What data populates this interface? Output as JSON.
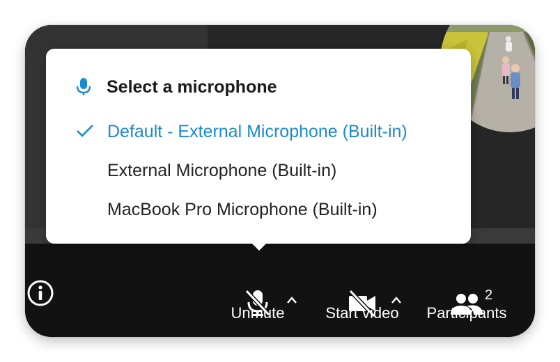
{
  "microphone_menu": {
    "title": "Select a microphone",
    "items": [
      {
        "label": "Default - External Microphone (Built-in)",
        "selected": true
      },
      {
        "label": "External Microphone (Built-in)",
        "selected": false
      },
      {
        "label": "MacBook Pro Microphone (Built-in)",
        "selected": false
      }
    ]
  },
  "toolbar": {
    "unmute_label": "Unmute",
    "start_video_label": "Start video",
    "participants_label": "Participants",
    "participants_count": "2"
  },
  "icons": {
    "menu_header": "microphone-icon",
    "selected_marker": "checkmark-icon",
    "info": "info-icon",
    "unmute": "microphone-muted-icon",
    "video": "video-off-icon",
    "participants": "participants-icon",
    "chevron": "chevron-up-icon"
  },
  "colors": {
    "accent": "#1a8ad0",
    "toolbar_bg": "#121212",
    "popup_bg": "#ffffff"
  }
}
